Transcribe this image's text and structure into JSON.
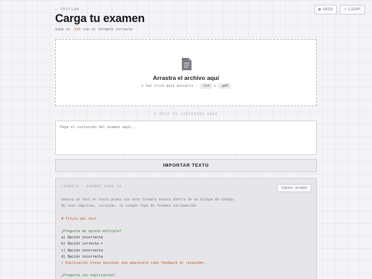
{
  "top_buttons": {
    "grid": "GRID",
    "light": "LIGHT"
  },
  "header": {
    "brand": "← TESTLAB",
    "title": "Carga tu examen",
    "subtitle_pre": "Sube un ",
    "subtitle_ext": ".txt",
    "subtitle_post": " con el formato correcto"
  },
  "dropzone": {
    "title": "Arrastra el archivo aquí",
    "sub_pre": "o haz click para buscarlo · ",
    "ext1": ".txt",
    "sub_mid": " o ",
    "ext2": ".pdf"
  },
  "divider": "O PEGA TU CONTENIDO AQUÍ",
  "paste": {
    "placeholder": "Pega el contenido del examen aquí..."
  },
  "import_button": "IMPORTAR TEXTO",
  "prompt": {
    "label": "FORMATO · PROMPT PARA IA",
    "copy_button": "Copiar prompt",
    "lines": [
      {
        "text": "Genera un test en texto plano con este formato exacto dentro de un bloque de código.",
        "tone": "gray"
      },
      {
        "text": "No uses negritas, cursivas, ni ningún tipo de formato enriquecido.",
        "tone": "gray"
      },
      {
        "text": "",
        "tone": "gray"
      },
      {
        "text": "# Título del test",
        "tone": "orange"
      },
      {
        "text": "",
        "tone": "gray"
      },
      {
        "text": "¿Pregunta de opción múltiple?",
        "tone": "green"
      },
      {
        "text": "a) Opción incorrecta",
        "tone": "dark"
      },
      {
        "text": "b) Opción correcta +",
        "tone": "dark"
      },
      {
        "text": "c) Opción incorrecta",
        "tone": "dark"
      },
      {
        "text": "d) Opción incorrecta",
        "tone": "dark"
      },
      {
        "text": "> Explicación breve opcional que aparecerá como feedback al responder.",
        "tone": "orange"
      },
      {
        "text": "",
        "tone": "gray"
      },
      {
        "text": "¿Pregunta sin explicación?",
        "tone": "green"
      }
    ]
  }
}
